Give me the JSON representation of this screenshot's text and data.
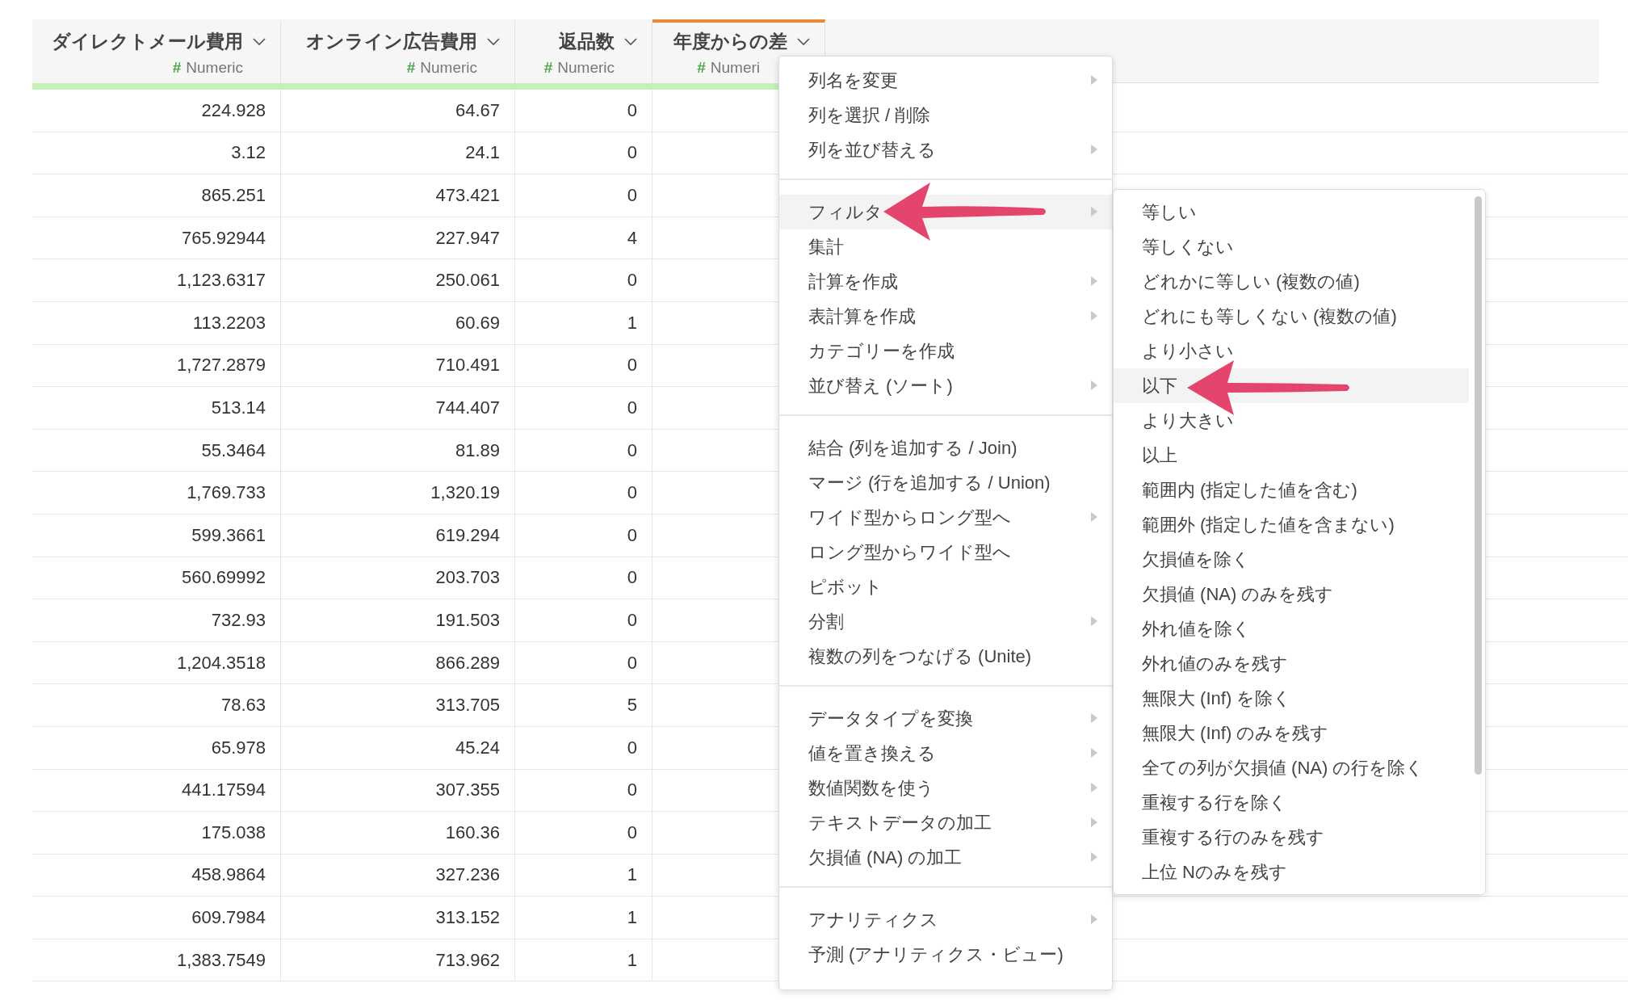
{
  "table": {
    "columns": [
      {
        "name": "ダイレクトメール費用",
        "type_symbol": "#",
        "type": "Numeric",
        "selected": false
      },
      {
        "name": "オンライン広告費用",
        "type_symbol": "#",
        "type": "Numeric",
        "selected": false
      },
      {
        "name": "返品数",
        "type_symbol": "#",
        "type": "Numeric",
        "selected": false
      },
      {
        "name": "年度からの差",
        "type_symbol": "#",
        "type": "Numeri",
        "selected": true
      }
    ],
    "rows": [
      [
        "224.928",
        "64.67",
        "0"
      ],
      [
        "3.12",
        "24.1",
        "0"
      ],
      [
        "865.251",
        "473.421",
        "0"
      ],
      [
        "765.92944",
        "227.947",
        "4"
      ],
      [
        "1,123.6317",
        "250.061",
        "0"
      ],
      [
        "113.2203",
        "60.69",
        "1"
      ],
      [
        "1,727.2879",
        "710.491",
        "0"
      ],
      [
        "513.14",
        "744.407",
        "0"
      ],
      [
        "55.3464",
        "81.89",
        "0"
      ],
      [
        "1,769.733",
        "1,320.19",
        "0"
      ],
      [
        "599.3661",
        "619.294",
        "0"
      ],
      [
        "560.69992",
        "203.703",
        "0"
      ],
      [
        "732.93",
        "191.503",
        "0"
      ],
      [
        "1,204.3518",
        "866.289",
        "0"
      ],
      [
        "78.63",
        "313.705",
        "5"
      ],
      [
        "65.978",
        "45.24",
        "0"
      ],
      [
        "441.17594",
        "307.355",
        "0"
      ],
      [
        "175.038",
        "160.36",
        "0"
      ],
      [
        "458.9864",
        "327.236",
        "1"
      ],
      [
        "609.7984",
        "313.152",
        "1"
      ],
      [
        "1,383.7549",
        "713.962",
        "1"
      ]
    ]
  },
  "context_menu": {
    "sections": [
      {
        "items": [
          {
            "label": "列名を変更",
            "submenu": true,
            "selected": false
          },
          {
            "label": "列を選択 / 削除",
            "submenu": false,
            "selected": false
          },
          {
            "label": "列を並び替える",
            "submenu": true,
            "selected": false
          }
        ]
      },
      {
        "items": [
          {
            "label": "フィルタ",
            "submenu": true,
            "selected": true
          },
          {
            "label": "集計",
            "submenu": false,
            "selected": false
          },
          {
            "label": "計算を作成",
            "submenu": true,
            "selected": false
          },
          {
            "label": "表計算を作成",
            "submenu": true,
            "selected": false
          },
          {
            "label": "カテゴリーを作成",
            "submenu": false,
            "selected": false
          },
          {
            "label": "並び替え (ソート)",
            "submenu": true,
            "selected": false
          }
        ]
      },
      {
        "items": [
          {
            "label": "結合 (列を追加する / Join)",
            "submenu": false,
            "selected": false
          },
          {
            "label": "マージ (行を追加する / Union)",
            "submenu": false,
            "selected": false
          },
          {
            "label": "ワイド型からロング型へ",
            "submenu": true,
            "selected": false
          },
          {
            "label": "ロング型からワイド型へ",
            "submenu": false,
            "selected": false
          },
          {
            "label": "ピボット",
            "submenu": false,
            "selected": false
          },
          {
            "label": "分割",
            "submenu": true,
            "selected": false
          },
          {
            "label": "複数の列をつなげる (Unite)",
            "submenu": false,
            "selected": false
          }
        ]
      },
      {
        "items": [
          {
            "label": "データタイプを変換",
            "submenu": true,
            "selected": false
          },
          {
            "label": "値を置き換える",
            "submenu": true,
            "selected": false
          },
          {
            "label": "数値関数を使う",
            "submenu": true,
            "selected": false
          },
          {
            "label": "テキストデータの加工",
            "submenu": true,
            "selected": false
          },
          {
            "label": "欠損値 (NA) の加工",
            "submenu": true,
            "selected": false
          }
        ]
      },
      {
        "items": [
          {
            "label": "アナリティクス",
            "submenu": true,
            "selected": false
          },
          {
            "label": "予測 (アナリティクス・ビュー)",
            "submenu": false,
            "selected": false
          }
        ]
      }
    ]
  },
  "filter_submenu": {
    "items": [
      {
        "label": "等しい",
        "selected": false
      },
      {
        "label": "等しくない",
        "selected": false
      },
      {
        "label": "どれかに等しい (複数の値)",
        "selected": false
      },
      {
        "label": "どれにも等しくない (複数の値)",
        "selected": false
      },
      {
        "label": "より小さい",
        "selected": false
      },
      {
        "label": "以下",
        "selected": true
      },
      {
        "label": "より大きい",
        "selected": false
      },
      {
        "label": "以上",
        "selected": false
      },
      {
        "label": "範囲内 (指定した値を含む)",
        "selected": false
      },
      {
        "label": "範囲外 (指定した値を含まない)",
        "selected": false
      },
      {
        "label": "欠損値を除く",
        "selected": false
      },
      {
        "label": "欠損値 (NA) のみを残す",
        "selected": false
      },
      {
        "label": "外れ値を除く",
        "selected": false
      },
      {
        "label": "外れ値のみを残す",
        "selected": false
      },
      {
        "label": "無限大 (Inf) を除く",
        "selected": false
      },
      {
        "label": "無限大 (Inf) のみを残す",
        "selected": false
      },
      {
        "label": "全ての列が欠損値 (NA) の行を除く",
        "selected": false
      },
      {
        "label": "重複する行を除く",
        "selected": false
      },
      {
        "label": "重複する行のみを残す",
        "selected": false
      },
      {
        "label": "上位 Nのみを残す",
        "selected": false
      }
    ]
  }
}
